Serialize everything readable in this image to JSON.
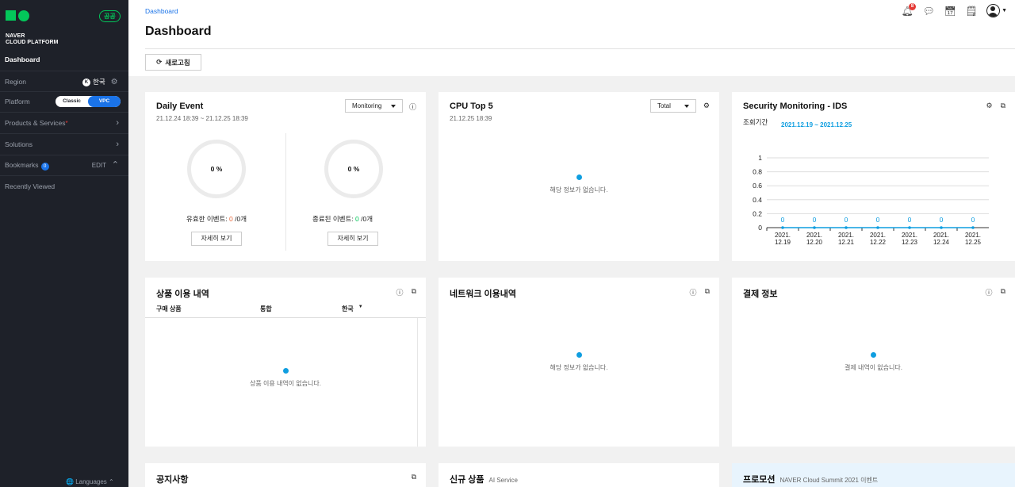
{
  "sidebar": {
    "logo_line1": "NAVER",
    "logo_line2": "CLOUD PLATFORM",
    "gov_badge": "공공",
    "dashboard": "Dashboard",
    "region_label": "Region",
    "region_value": "한국",
    "platform_label": "Platform",
    "platform_classic": "Classic",
    "platform_vpc": "VPC",
    "products": "Products & Services",
    "products_marker": "*",
    "solutions": "Solutions",
    "bookmarks": "Bookmarks",
    "bookmarks_count": "0",
    "bookmarks_edit": "EDIT",
    "recently_viewed": "Recently Viewed",
    "languages": "Languages"
  },
  "header": {
    "breadcrumb": "Dashboard",
    "title": "Dashboard",
    "refresh_label": "새로고침",
    "notification_count": "8"
  },
  "daily_event": {
    "title": "Daily Event",
    "range": "21.12.24 18:39 ~ 21.12.25 18:39",
    "dropdown": "Monitoring",
    "valid_pct": "0 %",
    "valid_label": "유효한 이벤트: ",
    "valid_count": "0",
    "valid_total": " /0개",
    "closed_pct": "0 %",
    "closed_label": "종료된 이벤트: ",
    "closed_count": "0",
    "closed_total": " /0개",
    "detail_btn": "자세히 보기"
  },
  "cpu": {
    "title": "CPU Top 5",
    "time": "21.12.25 18:39",
    "dropdown": "Total",
    "empty": "해당 정보가 없습니다."
  },
  "security": {
    "title": "Security Monitoring - IDS",
    "period_label": "조회기간",
    "period_value": "2021.12.19 ~ 2021.12.25"
  },
  "chart_data": {
    "type": "line",
    "title": "",
    "categories": [
      "2021.\n12.19",
      "2021.\n12.20",
      "2021.\n12.21",
      "2021.\n12.22",
      "2021.\n12.23",
      "2021.\n12.24",
      "2021.\n12.25"
    ],
    "values": [
      0,
      0,
      0,
      0,
      0,
      0,
      0
    ],
    "yticks": [
      "1",
      "0.8",
      "0.6",
      "0.4",
      "0.2",
      "0"
    ],
    "ylim": [
      0,
      1
    ],
    "grid": true,
    "color": "#0f9ee0"
  },
  "usage": {
    "title": "상품 이용 내역",
    "col_product": "구매 상품",
    "col_total": "통합",
    "col_region": "한국",
    "empty": "상품 이용 내역이 없습니다."
  },
  "network": {
    "title": "네트워크 이용내역",
    "empty": "해당 정보가 없습니다."
  },
  "billing": {
    "title": "결제 정보",
    "empty": "결제 내역이 없습니다."
  },
  "notice": {
    "title": "공지사항"
  },
  "new_products": {
    "title": "신규 상품",
    "subtitle": "AI Service"
  },
  "promotion": {
    "title": "프로모션",
    "subtitle": "NAVER Cloud Summit 2021 이벤트"
  }
}
